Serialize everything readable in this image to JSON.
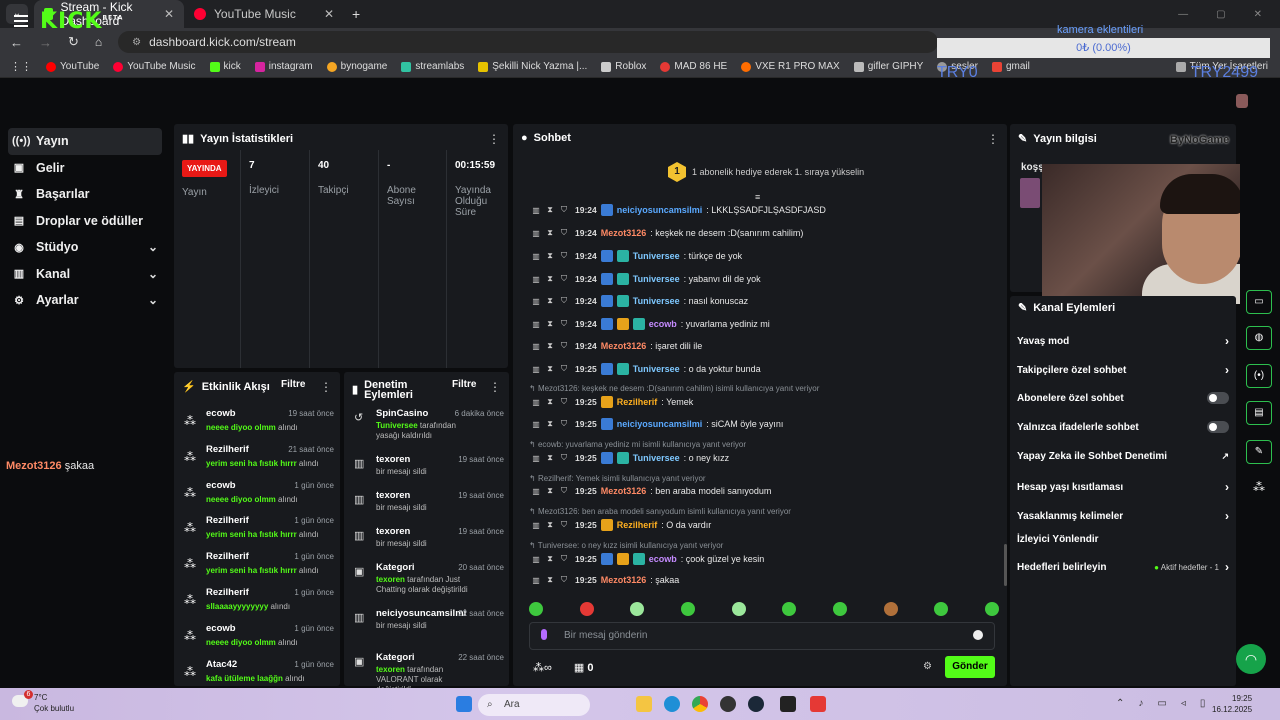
{
  "browser": {
    "tabs": [
      {
        "title": "Stream - Kick Dashboard",
        "active": true
      },
      {
        "title": "YouTube Music",
        "active": false
      }
    ],
    "url": "dashboard.kick.com/stream",
    "bookmarks": [
      "YouTube",
      "YouTube Music",
      "kick",
      "instagram",
      "bynogame",
      "streamlabs",
      "Şekilli Nick Yazma |...",
      "Roblox",
      "MAD 86 HE",
      "VXE R1 PRO MAX",
      "gifler GIPHY",
      "sesler",
      "gmail"
    ],
    "all_bookmarks": "Tüm Yer İşaretleri"
  },
  "overlay": {
    "title": "kamera eklentileri",
    "value": "0₺ (0.00%)",
    "left_label": "TRY0",
    "right_label": "TRY2499"
  },
  "sidebar": {
    "items": [
      {
        "label": "Yayın",
        "icon": "broadcast-icon",
        "active": true,
        "chevron": false
      },
      {
        "label": "Gelir",
        "icon": "wallet-icon",
        "active": false,
        "chevron": false
      },
      {
        "label": "Başarılar",
        "icon": "trophy-icon",
        "active": false,
        "chevron": false
      },
      {
        "label": "Droplar ve ödüller",
        "icon": "gift-icon",
        "active": false,
        "chevron": false
      },
      {
        "label": "Stüdyo",
        "icon": "palette-icon",
        "active": false,
        "chevron": true
      },
      {
        "label": "Kanal",
        "icon": "chart-icon",
        "active": false,
        "chevron": true
      },
      {
        "label": "Ayarlar",
        "icon": "gear-icon",
        "active": false,
        "chevron": true
      }
    ]
  },
  "floating_msg": {
    "user": "Mezot3126",
    "text": "şakaa"
  },
  "stats": {
    "title": "Yayın İstatistikleri",
    "live_badge": "YAYINDA",
    "columns": [
      {
        "value": "",
        "label": "Yayın"
      },
      {
        "value": "7",
        "label": "İzleyici"
      },
      {
        "value": "40",
        "label": "Takipçi"
      },
      {
        "value": "-",
        "label": "Abone Sayısı"
      },
      {
        "value": "00:15:59",
        "label": "Yayında Olduğu Süre"
      }
    ]
  },
  "activity": {
    "title": "Etkinlik Akışı",
    "filter": "Filtre",
    "items": [
      {
        "name": "ecowb",
        "time": "19 saat önce",
        "hl": "neeee diyoo olmm",
        "rest": " alındı"
      },
      {
        "name": "Rezilherif",
        "time": "21 saat önce",
        "hl": "yerim seni ha fıstık hırrr",
        "rest": " alındı"
      },
      {
        "name": "ecowb",
        "time": "1 gün önce",
        "hl": "neeee diyoo olmm",
        "rest": " alındı"
      },
      {
        "name": "Rezilherif",
        "time": "1 gün önce",
        "hl": "yerim seni ha fıstık hırrr",
        "rest": " alındı"
      },
      {
        "name": "Rezilherif",
        "time": "1 gün önce",
        "hl": "yerim seni ha fıstık hırrr",
        "rest": " alındı"
      },
      {
        "name": "Rezilherif",
        "time": "1 gün önce",
        "hl": "sllaaaayyyyyyyy",
        "rest": " alındı"
      },
      {
        "name": "ecowb",
        "time": "1 gün önce",
        "hl": "neeee diyoo olmm",
        "rest": " alındı"
      },
      {
        "name": "Atac42",
        "time": "1 gün önce",
        "hl": "kafa ütüleme laağğn",
        "rest": " alındı"
      }
    ]
  },
  "moderation": {
    "title": "Denetim Eylemleri",
    "filter": "Filtre",
    "items": [
      {
        "name": "SpinCasino",
        "time": "6 dakika önce",
        "hl": "Tuniversee",
        "rest": " tarafından yasağı kaldırıldı",
        "icon": "undo-icon"
      },
      {
        "name": "texoren",
        "time": "19 saat önce",
        "hl": "",
        "rest": "bir mesajı sildi",
        "icon": "trash-icon"
      },
      {
        "name": "texoren",
        "time": "19 saat önce",
        "hl": "",
        "rest": "bir mesajı sildi",
        "icon": "trash-icon"
      },
      {
        "name": "texoren",
        "time": "19 saat önce",
        "hl": "",
        "rest": "bir mesajı sildi",
        "icon": "trash-icon"
      },
      {
        "name": "Kategori",
        "time": "20 saat önce",
        "hl": "texoren",
        "rest": " tarafından Just Chatting olarak değiştirildi",
        "icon": "category-icon"
      },
      {
        "name": "neiciyosuncamsilmi",
        "time": "22 saat önce",
        "hl": "",
        "rest": "bir mesajı sildi",
        "icon": "trash-icon"
      },
      {
        "name": "Kategori",
        "time": "22 saat önce",
        "hl": "texoren",
        "rest": " tarafından VALORANT olarak değiştirildi",
        "icon": "category-icon"
      }
    ]
  },
  "chat": {
    "title": "Sohbet",
    "pinned": "1 abonelik hediye ederek 1. sıraya yükselin",
    "pinned_rank": "1",
    "messages": [
      {
        "kind": "msg",
        "time": "19:24",
        "user": "neiciyosuncamsilmi",
        "color": "#5aa9ff",
        "text": ": LKKLŞSADFJLŞASDFJASD",
        "badges": [
          "#3a7bd5"
        ]
      },
      {
        "kind": "msg",
        "time": "19:24",
        "user": "Mezot3126",
        "color": "#ff8a65",
        "text": ": keşkek ne desem :D(sanırım cahilim)",
        "badges": []
      },
      {
        "kind": "msg",
        "time": "19:24",
        "user": "Tuniversee",
        "color": "#7ec8ff",
        "text": ": türkçe de yok",
        "badges": [
          "#3a7bd5",
          "#2bb3a3"
        ]
      },
      {
        "kind": "msg",
        "time": "19:24",
        "user": "Tuniversee",
        "color": "#7ec8ff",
        "text": ": yabanvı dil de yok",
        "badges": [
          "#3a7bd5",
          "#2bb3a3"
        ]
      },
      {
        "kind": "msg",
        "time": "19:24",
        "user": "Tuniversee",
        "color": "#7ec8ff",
        "text": ": nasıl konuscaz",
        "badges": [
          "#3a7bd5",
          "#2bb3a3"
        ]
      },
      {
        "kind": "msg",
        "time": "19:24",
        "user": "ecowb",
        "color": "#c58bff",
        "text": ": yuvarlama yediniz mi",
        "badges": [
          "#3a7bd5",
          "#e7a21a",
          "#2bb3a3"
        ]
      },
      {
        "kind": "msg",
        "time": "19:24",
        "user": "Mezot3126",
        "color": "#ff8a65",
        "text": ": işaret dili ile",
        "badges": []
      },
      {
        "kind": "msg",
        "time": "19:25",
        "user": "Tuniversee",
        "color": "#7ec8ff",
        "text": ": o da yoktur bunda",
        "badges": [
          "#3a7bd5",
          "#2bb3a3"
        ]
      },
      {
        "kind": "reply",
        "text": "Mezot3126: keşkek ne desem :D(sanırım cahilim) isimli kullanıcıya yanıt veriyor"
      },
      {
        "kind": "msg",
        "time": "19:25",
        "user": "Rezilherif",
        "color": "#ffb020",
        "text": ": Yemek",
        "badges": [
          "#e7a21a"
        ]
      },
      {
        "kind": "msg",
        "time": "19:25",
        "user": "neiciyosuncamsilmi",
        "color": "#5aa9ff",
        "text": ": siCAM öyle yayını",
        "badges": [
          "#3a7bd5"
        ]
      },
      {
        "kind": "reply",
        "text": "ecowb: yuvarlama yediniz mi isimli kullanıcıya yanıt veriyor"
      },
      {
        "kind": "msg",
        "time": "19:25",
        "user": "Tuniversee",
        "color": "#7ec8ff",
        "text": ": o ney kızz",
        "badges": [
          "#3a7bd5",
          "#2bb3a3"
        ]
      },
      {
        "kind": "reply",
        "text": "Rezilherif: Yemek isimli kullanıcıya yanıt veriyor"
      },
      {
        "kind": "msg",
        "time": "19:25",
        "user": "Mezot3126",
        "color": "#ff8a65",
        "text": ": ben araba modeli sanıyodum",
        "badges": []
      },
      {
        "kind": "reply",
        "text": "Mezot3126: ben araba modeli sanıyodum isimli kullanıcıya yanıt veriyor"
      },
      {
        "kind": "msg",
        "time": "19:25",
        "user": "Rezilherif",
        "color": "#ffb020",
        "text": ": O da vardır",
        "badges": [
          "#e7a21a"
        ]
      },
      {
        "kind": "reply",
        "text": "Tuniversee: o ney kızz isimli kullanıcıya yanıt veriyor"
      },
      {
        "kind": "msg",
        "time": "19:25",
        "user": "ecowb",
        "color": "#c58bff",
        "text": ": çook güzel ye kesin",
        "badges": [
          "#3a7bd5",
          "#e7a21a",
          "#2bb3a3"
        ]
      },
      {
        "kind": "msg",
        "time": "19:25",
        "user": "Mezot3126",
        "color": "#ff8a65",
        "text": ": şakaa",
        "badges": []
      }
    ],
    "input_placeholder": "Bir mesaj gönderin",
    "send_label": "Gönder",
    "points": "0"
  },
  "stream_info": {
    "title": "Yayın bilgisi",
    "text": "koşş"
  },
  "watermark": "ByNoGame",
  "chat_settings": {
    "title": "Kanal Eylemleri",
    "items": [
      {
        "label": "Yavaş mod",
        "control": "chevron"
      },
      {
        "label": "Takipçilere özel sohbet",
        "control": "chevron"
      },
      {
        "label": "Abonelere özel sohbet",
        "control": "toggle"
      },
      {
        "label": "Yalnızca ifadelerle sohbet",
        "control": "toggle"
      },
      {
        "label": "Yapay Zeka ile Sohbet Denetimi",
        "control": "external"
      },
      {
        "label": "Hesap yaşı kısıtlaması",
        "control": "chevron"
      },
      {
        "label": "Yasaklanmış kelimeler",
        "control": "chevron"
      },
      {
        "label": "İzleyici Yönlendir",
        "control": "none"
      },
      {
        "label": "Hedefleri belirleyin",
        "control": "chevron",
        "extra": "Aktif hedefler - 1"
      }
    ]
  },
  "taskbar": {
    "temp": "7°C",
    "weather": "Çok bulutlu",
    "search": "Ara",
    "time": "19:25",
    "date": "16.12.2025",
    "notif_badge": "6"
  },
  "colors": {
    "accent": "#53fc18",
    "live": "#e91916"
  }
}
